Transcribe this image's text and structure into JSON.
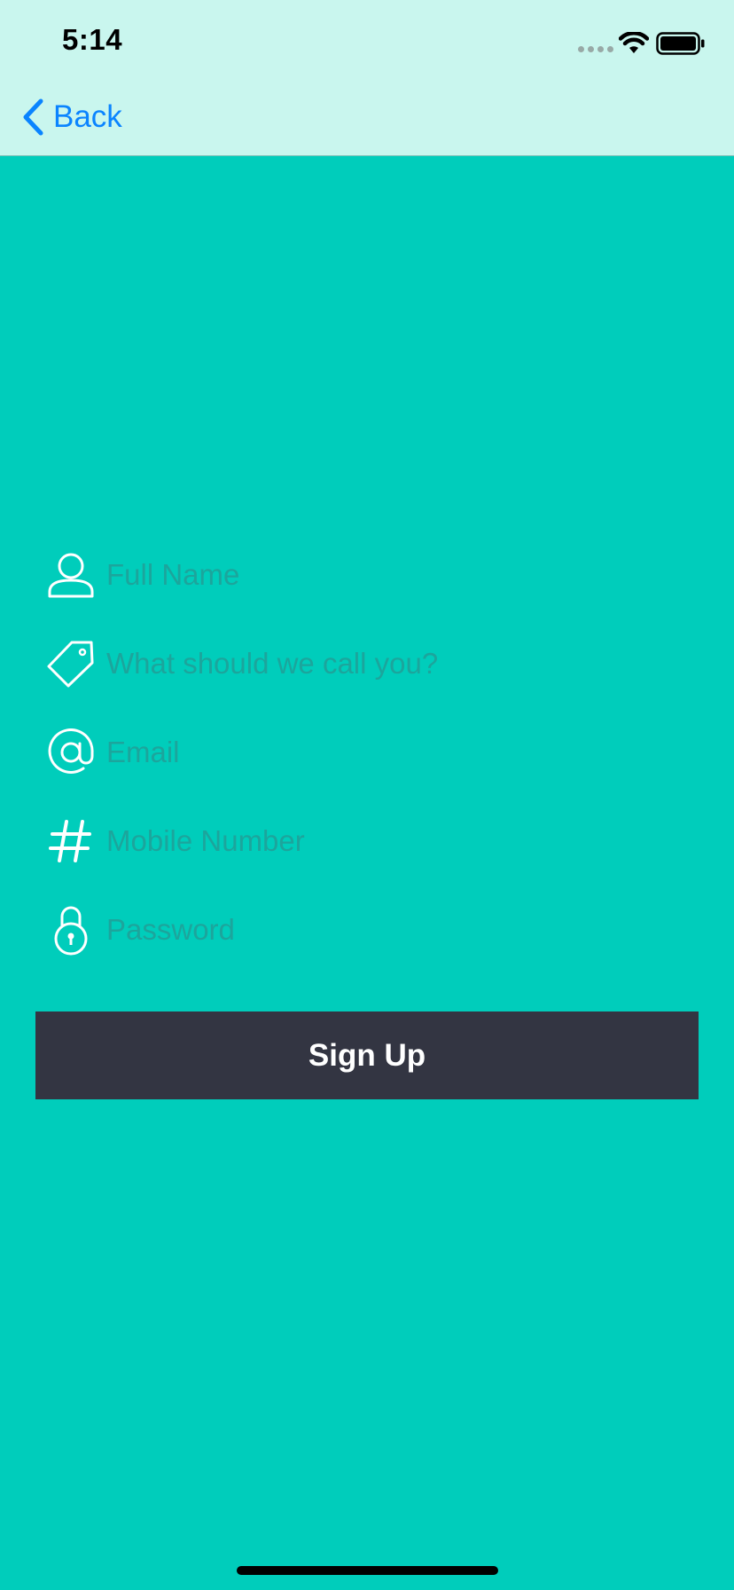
{
  "status_bar": {
    "time": "5:14"
  },
  "nav": {
    "back_label": "Back",
    "back_icon": "chevron-left-icon"
  },
  "form": {
    "fields": [
      {
        "icon": "user-icon",
        "placeholder": "Full Name",
        "value": ""
      },
      {
        "icon": "tag-icon",
        "placeholder": "What should we call you?",
        "value": ""
      },
      {
        "icon": "at-sign-icon",
        "placeholder": "Email",
        "value": ""
      },
      {
        "icon": "hash-icon",
        "placeholder": "Mobile Number",
        "value": ""
      },
      {
        "icon": "lock-icon",
        "placeholder": "Password",
        "value": ""
      }
    ]
  },
  "signup_button": {
    "label": "Sign Up"
  },
  "colors": {
    "background": "#00CDBB",
    "nav_background": "#C9F6EE",
    "accent": "#0A84FF",
    "button_background": "#333542",
    "placeholder": "#1CA59C"
  }
}
